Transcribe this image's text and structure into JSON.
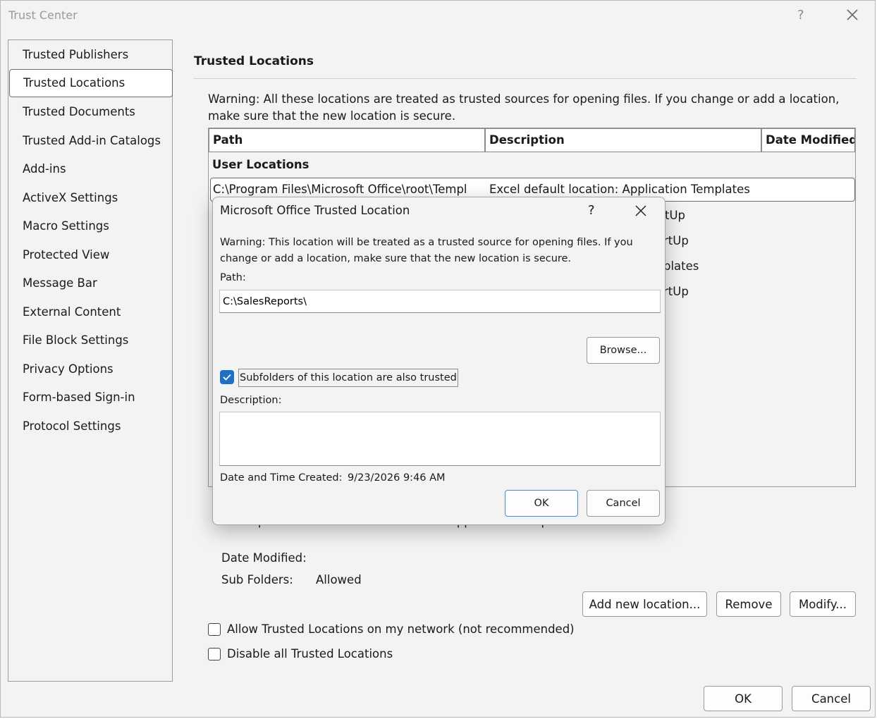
{
  "window": {
    "title": "Trust Center",
    "help_label": "?"
  },
  "sidebar": {
    "items": [
      {
        "label": "Trusted Publishers"
      },
      {
        "label": "Trusted Locations"
      },
      {
        "label": "Trusted Documents"
      },
      {
        "label": "Trusted Add-in Catalogs"
      },
      {
        "label": "Add-ins"
      },
      {
        "label": "ActiveX Settings"
      },
      {
        "label": "Macro Settings"
      },
      {
        "label": "Protected View"
      },
      {
        "label": "Message Bar"
      },
      {
        "label": "External Content"
      },
      {
        "label": "File Block Settings"
      },
      {
        "label": "Privacy Options"
      },
      {
        "label": "Form-based Sign-in"
      },
      {
        "label": "Protocol Settings"
      }
    ],
    "selected": "Trusted Locations"
  },
  "main": {
    "title": "Trusted Locations",
    "warning": "Warning: All these locations are treated as trusted sources for opening files.  If you change or add a location, make sure that the new location is secure.",
    "table": {
      "columns": [
        "Path",
        "Description",
        "Date Modified"
      ],
      "group_label": "User Locations",
      "rows": [
        {
          "path": "C:\\Program Files\\Microsoft Office\\root\\Templ",
          "description": "Excel default location: Application Templates"
        },
        {
          "path": "",
          "description": "tUp"
        },
        {
          "path": "",
          "description": "rtUp"
        },
        {
          "path": "",
          "description": "plates"
        },
        {
          "path": "",
          "description": "rtUp"
        }
      ]
    },
    "details": {
      "description_label": "Description:",
      "description_value": "Excel default location: Application Templates",
      "date_modified_label": "Date Modified:",
      "sub_folders_label": "Sub Folders:",
      "sub_folders_value": "Allowed"
    },
    "buttons": {
      "add": "Add new location...",
      "remove": "Remove",
      "modify": "Modify..."
    },
    "options": {
      "allow_network": "Allow Trusted Locations on my network (not recommended)",
      "allow_network_checked": false,
      "disable_all": "Disable all Trusted Locations",
      "disable_all_checked": false
    }
  },
  "footer": {
    "ok": "OK",
    "cancel": "Cancel"
  },
  "dialog": {
    "title": "Microsoft Office Trusted Location",
    "help_label": "?",
    "warning": "Warning: This location will be treated as a trusted source for opening files. If you change or add a location, make sure that the new location is secure.",
    "path_label": "Path:",
    "path_value": "C:\\SalesReports\\",
    "browse": "Browse...",
    "subfolders_label": "Subfolders of this location are also trusted",
    "subfolders_checked": true,
    "description_label": "Description:",
    "description_value": "",
    "created_label": "Date and Time Created:",
    "created_value": "9/23/2026 9:46 AM",
    "ok": "OK",
    "cancel": "Cancel"
  },
  "colors": {
    "accent": "#1f6fc5",
    "window_bg": "#f3f3f3"
  }
}
